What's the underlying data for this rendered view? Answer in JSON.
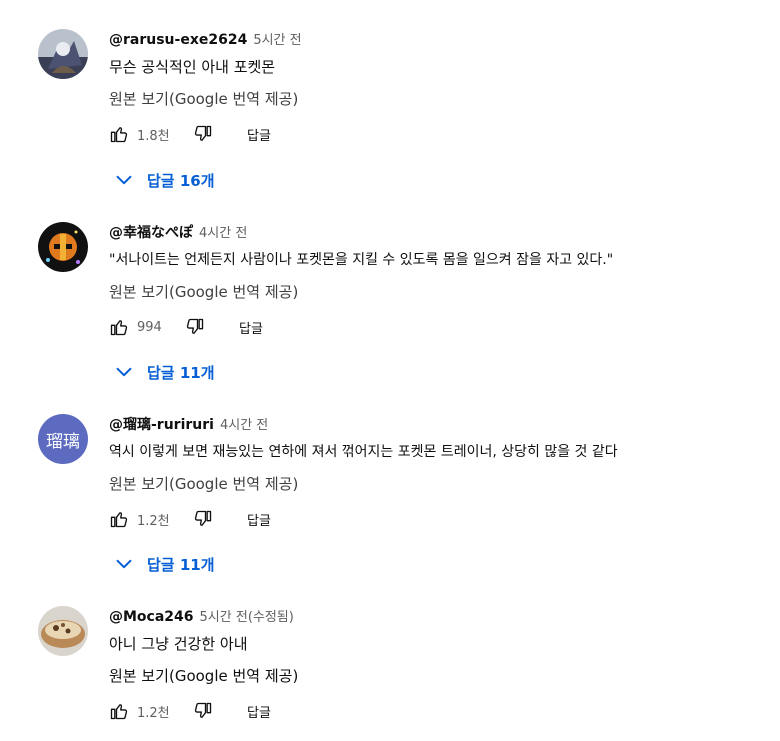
{
  "comments": [
    {
      "author": "@rarusu-exe2624",
      "time": "5시간 전",
      "text": "무슨 공식적인 아내 포켓몬",
      "translate_label": "원본 보기(Google 번역 제공)",
      "likes": "1.8천",
      "reply_label": "답글",
      "replies_label": "답글 16개"
    },
    {
      "author": "@幸福なぺぽ",
      "time": "4시간 전",
      "text": "\"서나이트는 언제든지 사람이나 포켓몬을 지킬 수 있도록 몸을 일으켜 잠을 자고 있다.\"",
      "translate_label": "원본 보기(Google 번역 제공)",
      "likes": "994",
      "reply_label": "답글",
      "replies_label": "답글 11개"
    },
    {
      "author": "@瑠璃-ruriruri",
      "time": "4시간 전",
      "avatar_text": "瑠璃",
      "text": "역시 이렇게 보면 재능있는 연하에 져서 꺾어지는 포켓몬 트레이너, 상당히 많을 것 같다",
      "translate_label": "원본 보기(Google 번역 제공)",
      "likes": "1.2천",
      "reply_label": "답글",
      "replies_label": "답글 11개"
    },
    {
      "author": "@Moca246",
      "time": "5시간 전(수정됨)",
      "text": "아니 그냥 건강한 아내",
      "translate_label": "원본 보기(Google 번역 제공)",
      "likes": "1.2천",
      "reply_label": "답글"
    }
  ],
  "colors": {
    "link_blue": "#065fd4",
    "avatar_ruri": "#5c6bc0"
  },
  "icons": [
    "thumb-up-icon",
    "thumb-down-icon",
    "chevron-down-icon"
  ]
}
